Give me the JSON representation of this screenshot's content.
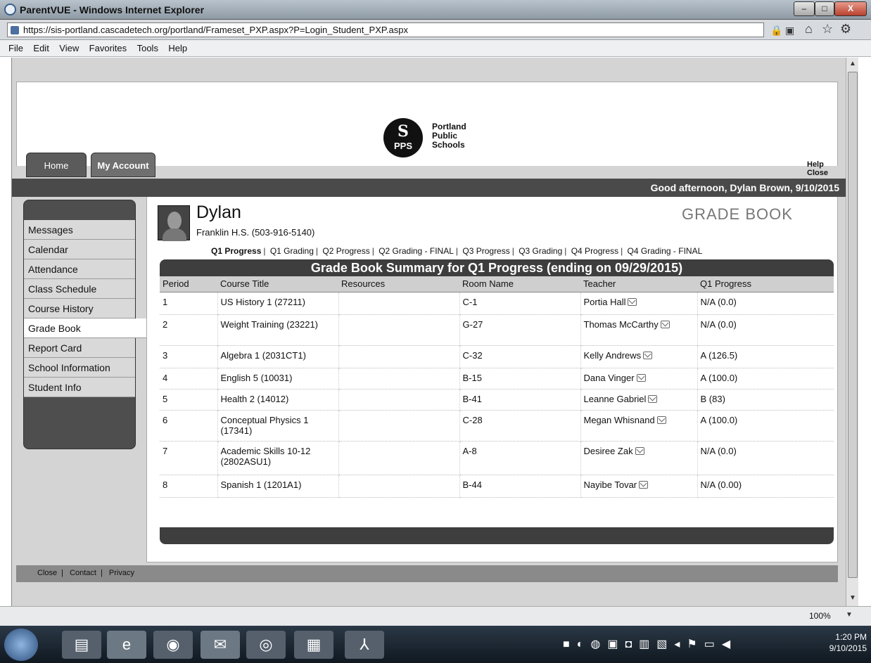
{
  "browser": {
    "window_title": "ParentVUE - Windows Internet Explorer",
    "url": "https://sis-portland.cascadetech.org/portland/Frameset_PXP.aspx?P=Login_Student_PXP.aspx",
    "menu": [
      "File",
      "Edit",
      "View",
      "Favorites",
      "Tools",
      "Help"
    ],
    "zoom": "100%",
    "window_buttons": {
      "minimize": "–",
      "maximize": "□",
      "close": "X"
    }
  },
  "banner": {
    "logo_text": "PPS",
    "logo_glyph": "S",
    "name_lines": [
      "Portland",
      "Public",
      "Schools"
    ]
  },
  "nav_tabs": [
    "Home",
    "My Account"
  ],
  "header_links": [
    "Help",
    "Close"
  ],
  "greeting": "Good afternoon, Dylan Brown, 9/10/2015",
  "sidebar": {
    "items": [
      {
        "label": "Messages"
      },
      {
        "label": "Calendar"
      },
      {
        "label": "Attendance"
      },
      {
        "label": "Class Schedule"
      },
      {
        "label": "Course History"
      },
      {
        "label": "Grade Book"
      },
      {
        "label": "Report Card"
      },
      {
        "label": "School Information"
      },
      {
        "label": "Student Info"
      }
    ],
    "active": "Grade Book"
  },
  "student": {
    "name": "Dylan",
    "school": "Franklin H.S. (503-916-5140)"
  },
  "page_title": "GRADE BOOK",
  "periods": [
    "Q1 Progress",
    "Q1 Grading",
    "Q2 Progress",
    "Q2 Grading - FINAL",
    "Q3 Progress",
    "Q3 Grading",
    "Q4 Progress",
    "Q4 Grading - FINAL"
  ],
  "active_period": "Q1 Progress",
  "summary_title": "Grade Book Summary for Q1 Progress (ending on 09/29/2015)",
  "table": {
    "columns": [
      "Period",
      "Course Title",
      "Resources",
      "Room Name",
      "Teacher",
      "Q1 Progress"
    ],
    "rows": [
      {
        "period": "1",
        "course": "US History 1 (27211)",
        "resources": "",
        "room": "C-1",
        "teacher": "Portia Hall",
        "grade": "N/A (0.0)"
      },
      {
        "period": "2",
        "course": "Weight Training (23221)",
        "resources": "",
        "room": "G-27",
        "teacher": "Thomas McCarthy",
        "grade": "N/A (0.0)"
      },
      {
        "period": "3",
        "course": "Algebra 1 (2031CT1)",
        "resources": "",
        "room": "C-32",
        "teacher": "Kelly Andrews",
        "grade": "A (126.5)"
      },
      {
        "period": "4",
        "course": "English 5 (10031)",
        "resources": "",
        "room": "B-15",
        "teacher": "Dana Vinger",
        "grade": "A (100.0)"
      },
      {
        "period": "5",
        "course": "Health 2 (14012)",
        "resources": "",
        "room": "B-41",
        "teacher": "Leanne Gabriel",
        "grade": "B (83)"
      },
      {
        "period": "6",
        "course": "Conceptual Physics 1 (17341)",
        "resources": "",
        "room": "C-28",
        "teacher": "Megan Whisnand",
        "grade": "A (100.0)"
      },
      {
        "period": "7",
        "course": "Academic Skills 10-12 (2802ASU1)",
        "resources": "",
        "room": "A-8",
        "teacher": "Desiree Zak",
        "grade": "N/A (0.0)"
      },
      {
        "period": "8",
        "course": "Spanish 1 (1201A1)",
        "resources": "",
        "room": "B-44",
        "teacher": "Nayibe Tovar",
        "grade": "N/A (0.00)"
      }
    ]
  },
  "footer_links": [
    "Close",
    "Contact",
    "Privacy"
  ],
  "taskbar": {
    "clock_time": "1:20 PM",
    "clock_date": "9/10/2015",
    "icons": [
      "start-icon",
      "file-explorer-icon",
      "internet-explorer-icon",
      "camera-icon",
      "outlook-icon",
      "chrome-icon",
      "apps-icon",
      "acrobat-icon"
    ]
  }
}
